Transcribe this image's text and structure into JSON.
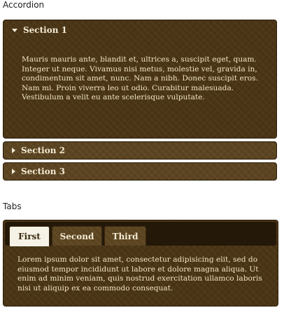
{
  "accordion": {
    "heading": "Accordion",
    "sections": [
      {
        "title": "Section 1",
        "expanded": true,
        "content": "Mauris mauris ante, blandit et, ultrices a, suscipit eget, quam. Integer ut neque. Vivamus nisi metus, molestie vel, gravida in, condimentum sit amet, nunc. Nam a nibh. Donec suscipit eros. Nam mi. Proin viverra leo ut odio. Curabitur malesuada. Vestibulum a velit eu ante scelerisque vulputate."
      },
      {
        "title": "Section 2",
        "expanded": false
      },
      {
        "title": "Section 3",
        "expanded": false
      }
    ]
  },
  "tabs": {
    "heading": "Tabs",
    "items": [
      {
        "label": "First",
        "active": true
      },
      {
        "label": "Second",
        "active": false
      },
      {
        "label": "Third",
        "active": false
      }
    ],
    "content": "Lorem ipsum dolor sit amet, consectetur adipisicing elit, sed do eiusmod tempor incididunt ut labore et dolore magna aliqua. Ut enim ad minim veniam, quis nostrud exercitation ullamco laboris nisi ut aliquip ex ea commodo consequat."
  },
  "colors": {
    "panel": "#4a3517",
    "header_closed": "#5b4421",
    "text": "#f1e4c3",
    "active_tab": "#f6f2e6"
  }
}
